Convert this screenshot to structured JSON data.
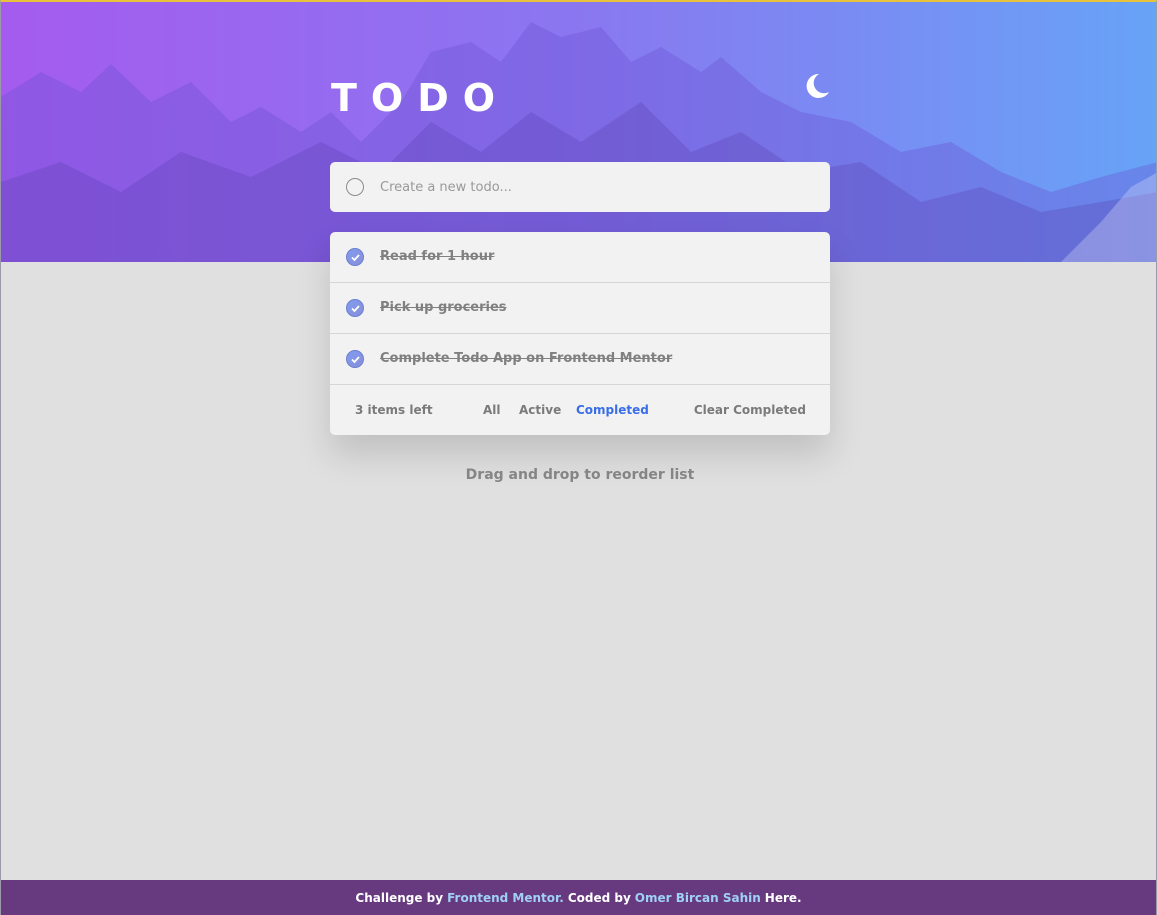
{
  "header": {
    "title": "TODO",
    "theme_icon": "moon-icon"
  },
  "new_todo": {
    "placeholder": "Create a new todo..."
  },
  "todos": [
    {
      "text": "Read for 1 hour",
      "completed": true
    },
    {
      "text": "Pick up groceries",
      "completed": true
    },
    {
      "text": "Complete Todo App on Frontend Mentor",
      "completed": true
    }
  ],
  "footer": {
    "items_left": "3 items left",
    "filters": [
      "All",
      "Active",
      "Completed"
    ],
    "active_filter": "Completed",
    "clear_label": "Clear Completed"
  },
  "hint": "Drag and drop to reorder list",
  "attribution": {
    "prefix": "Challenge by",
    "challenge_link": "Frontend Mentor.",
    "middle": "Coded by",
    "author_link": "Omer Bircan Sahin",
    "suffix": "Here."
  },
  "colors": {
    "accent": "#3a6ee8",
    "hero_gradient_start": "#a55bef",
    "hero_gradient_end": "#67a3f7",
    "attribution_bg": "#673a80"
  }
}
